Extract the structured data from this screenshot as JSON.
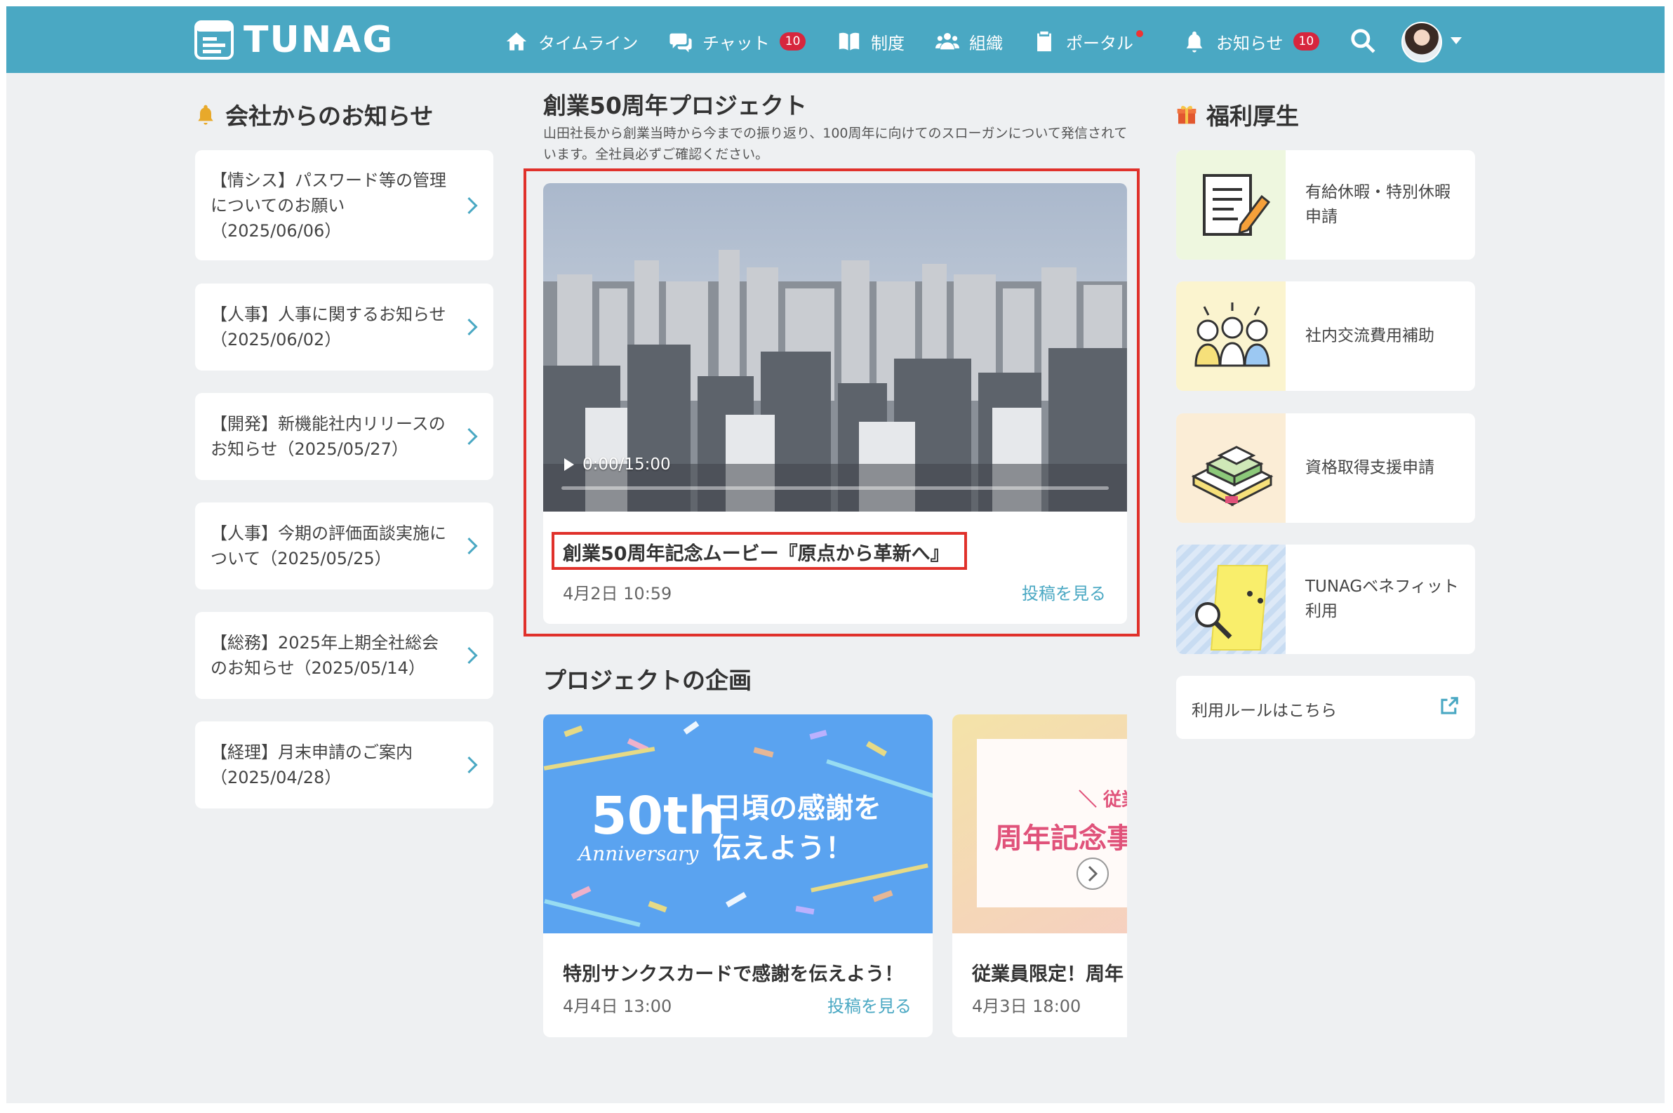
{
  "header": {
    "logo_text": "TUNAG",
    "nav": [
      {
        "label": "タイムライン",
        "icon": "home-icon"
      },
      {
        "label": "チャット",
        "icon": "chat-icon",
        "badge": "10"
      },
      {
        "label": "制度",
        "icon": "book-icon"
      },
      {
        "label": "組織",
        "icon": "people-icon"
      },
      {
        "label": "ポータル",
        "icon": "clipboard-icon",
        "dot": true
      },
      {
        "label": "お知らせ",
        "icon": "bell-icon",
        "badge": "10"
      }
    ],
    "search_icon": "search-icon",
    "avatar": "user-avatar"
  },
  "notices": {
    "title": "会社からのお知らせ",
    "icon": "bell-icon",
    "items": [
      {
        "text": "【情シス】パスワード等の管理についてのお願い（2025/06/06）"
      },
      {
        "text": "【人事】人事に関するお知らせ（2025/06/02）"
      },
      {
        "text": "【開発】新機能社内リリースのお知らせ（2025/05/27）"
      },
      {
        "text": "【人事】今期の評価面談実施について（2025/05/25）"
      },
      {
        "text": "【総務】2025年上期全社総会のお知らせ（2025/05/14）"
      },
      {
        "text": "【経理】月末申請のご案内（2025/04/28）"
      }
    ]
  },
  "project": {
    "title": "創業50周年プロジェクト",
    "description": "山田社長から創業当時から今までの振り返り、100周年に向けてのスローガンについて発信されています。全社員必ずご確認ください。",
    "video": {
      "time": "0:00/15:00",
      "title": "創業50周年記念ムービー『原点から革新へ』",
      "date": "4月2日 10:59",
      "link": "投稿を見る"
    }
  },
  "plans": {
    "title": "プロジェクトの企画",
    "cards": [
      {
        "banner_big": "50th",
        "banner_script": "Anniversary",
        "banner_line1": "日頃の感謝を",
        "banner_line2": "伝えよう！",
        "title": "特別サンクスカードで感謝を伝えよう！",
        "date": "4月4日 13:00",
        "link": "投稿を見る"
      },
      {
        "banner_line1": "＼ 従業",
        "banner_line2": "周年記念事",
        "title": "従業員限定！周年",
        "date": "4月3日 18:00"
      }
    ]
  },
  "benefits": {
    "title": "福利厚生",
    "icon": "gift-icon",
    "items": [
      {
        "label": "有給休暇・特別休暇申請",
        "bg": "#eef7df"
      },
      {
        "label": "社内交流費用補助",
        "bg": "#fbf4cf"
      },
      {
        "label": "資格取得支援申請",
        "bg": "#fbedd6"
      },
      {
        "label": "TUNAGベネフィット利用",
        "bg": "#dde9f7"
      }
    ],
    "rules_link": "利用ルールはこちら"
  },
  "colors": {
    "header": "#4aa8c3",
    "accent": "#4aa8c3",
    "highlight": "#e0312b",
    "badge": "#d7263d"
  }
}
